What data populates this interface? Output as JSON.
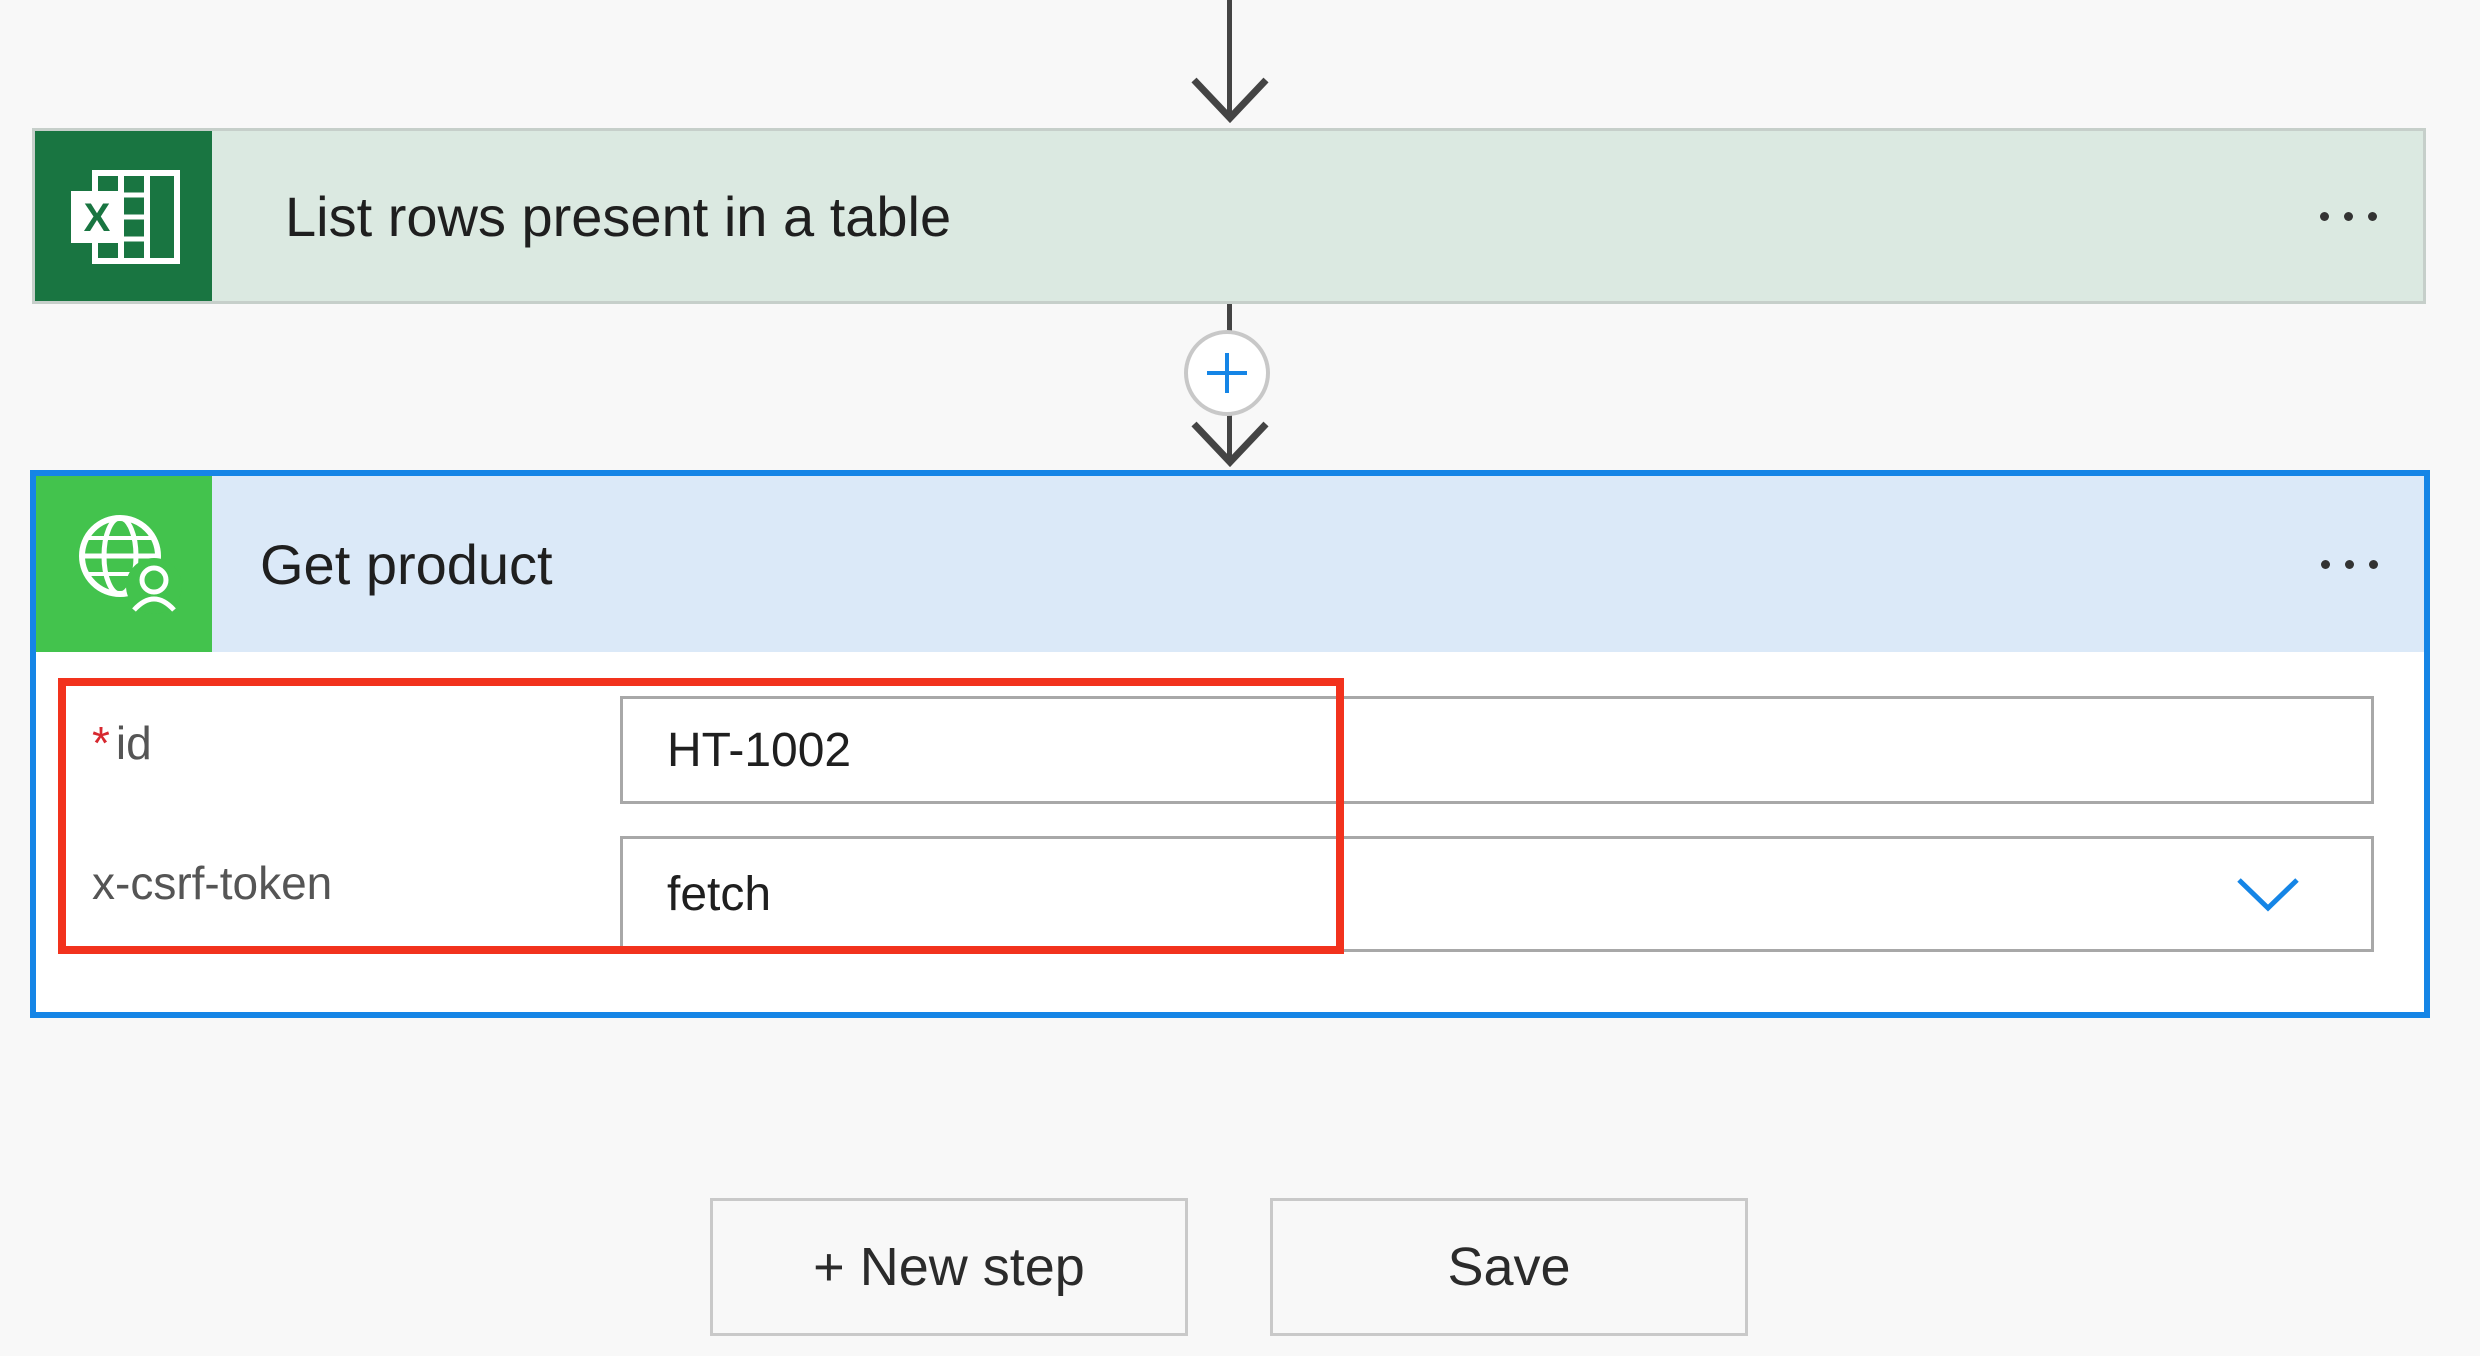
{
  "flow": {
    "steps": [
      {
        "title": "List rows present in a table",
        "icon": "excel-icon",
        "accent": "#197541",
        "header_bg": "#dbe9e1"
      },
      {
        "title": "Get product",
        "icon": "globe-user-icon",
        "accent": "#43c34d",
        "header_bg": "#dbe9f8",
        "selected_border": "#1585e6",
        "fields": [
          {
            "label": "id",
            "required": true,
            "value": "HT-1002"
          },
          {
            "label": "x-csrf-token",
            "required": false,
            "value": "fetch",
            "type": "dropdown"
          }
        ]
      }
    ],
    "excel_glyph": "X"
  },
  "insert_step_icon": "plus-icon",
  "highlight_color": "#f2321d",
  "buttons": {
    "new_step": "+ New step",
    "save": "Save"
  }
}
